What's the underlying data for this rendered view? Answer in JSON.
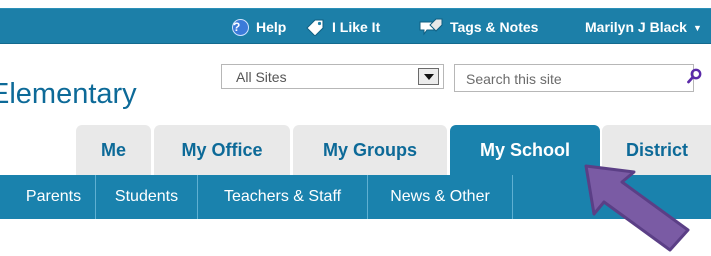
{
  "ribbon": {
    "help_label": "Help",
    "like_label": "I Like It",
    "tags_label": "Tags & Notes",
    "user_name": "Marilyn J Black"
  },
  "site": {
    "title": "Elementary"
  },
  "search": {
    "scope_value": "All Sites",
    "placeholder": "Search this site"
  },
  "tabs": [
    {
      "label": "Me"
    },
    {
      "label": "My Office"
    },
    {
      "label": "My Groups"
    },
    {
      "label": "My School",
      "active": true
    },
    {
      "label": "District"
    }
  ],
  "subnav": [
    {
      "label": "Parents"
    },
    {
      "label": "Students"
    },
    {
      "label": "Teachers & Staff"
    },
    {
      "label": "News & Other"
    }
  ],
  "colors": {
    "ribbon": "#1c7fa8",
    "accent": "#1a82ad",
    "title_text": "#0d6a98",
    "tab_bg": "#e9e9e9",
    "callout_fill": "#7a5ba4",
    "callout_stroke": "#5b3f86"
  },
  "icons": {
    "help": "help-icon",
    "like": "tag-like-icon",
    "tags": "tags-notes-icon",
    "search": "search-icon",
    "dropdown": "chevron-down-icon",
    "callout": "callout-arrow-icon"
  }
}
